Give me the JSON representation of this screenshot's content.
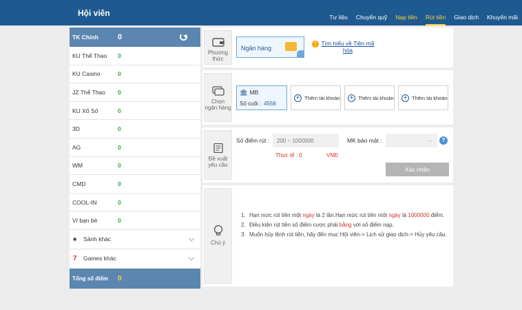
{
  "header": {
    "title": "Hội viên",
    "nav": [
      "Tư liệu",
      "Chuyển quỹ",
      "Nạp tiền",
      "Rút tiền",
      "Giao dịch",
      "Khuyến mãi"
    ]
  },
  "sidebar": {
    "main_label": "TK Chính",
    "main_value": "0",
    "rows": [
      {
        "label": "KU Thể Thao",
        "value": "0"
      },
      {
        "label": "KU Casino",
        "value": "0"
      },
      {
        "label": "JZ Thể Thao",
        "value": "0"
      },
      {
        "label": "KU Xổ Số",
        "value": "0"
      },
      {
        "label": "3D",
        "value": "0"
      },
      {
        "label": "AG",
        "value": "0"
      },
      {
        "label": "WM",
        "value": "0"
      },
      {
        "label": "CMD",
        "value": "0"
      },
      {
        "label": "COOL-IN",
        "value": "0"
      },
      {
        "label": "Ví bạn bè",
        "value": "0"
      }
    ],
    "more1": "Sảnh khác",
    "more2": "Games khác",
    "total_label": "Tổng số điểm",
    "total_value": "0"
  },
  "method": {
    "step_label": "Phương thức",
    "bank_option": "Ngân hàng",
    "learn_link": "Tìm hiểu về Tiền mã hóa"
  },
  "bank_select": {
    "step_label": "Chọn ngân hàng",
    "selected_bank": "MB",
    "tail_label": "Số cuối :",
    "tail_number": "4556",
    "add_label": "Thêm tài khoản"
  },
  "request": {
    "step_label": "Đề xuất yêu cầu",
    "points_label": "Số điểm rút :",
    "points_placeholder": "200 ~ 1000000",
    "actual_label": "Thực tế : 0",
    "currency": "VNĐ",
    "pass_label": "MK bảo mật :",
    "confirm": "Xác nhận"
  },
  "notice": {
    "step_label": "Chú ý",
    "items": [
      {
        "n": "1.",
        "t1": "Hạn mức rút tiền một ",
        "r1": "ngày",
        "t2": " là 2 lần.Hạn mức rút tiền một ",
        "r2": "ngày",
        "t3": " là ",
        "r3": "1000000",
        "t4": " điểm."
      },
      {
        "n": "2.",
        "t1": "Điều kiện rút tiền số điểm cược phải ",
        "r1": "bằng",
        "t2": " với số điểm nạp."
      },
      {
        "n": "3.",
        "t1": "Muốn hủy lệnh rút tiền, hãy đến mục Hội viên-> Lịch sử giao dịch-> Hủy yêu cầu."
      }
    ]
  },
  "colors": {
    "header": "#1e5a8f",
    "sidebar_head": "#5b86b0",
    "accent_yellow": "#ffd23f",
    "value_green": "#2ea84a",
    "warn_red": "#d32f2f"
  }
}
